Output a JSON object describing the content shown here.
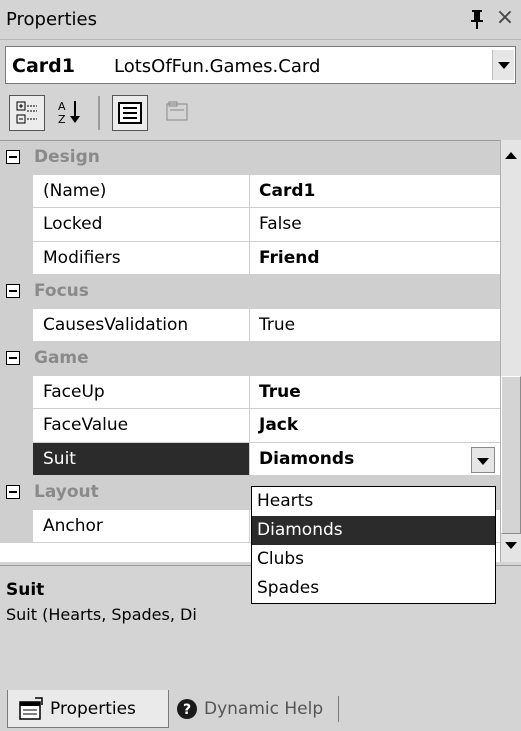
{
  "window": {
    "title": "Properties",
    "pin_glyph": "ᵖ",
    "close_glyph": "×"
  },
  "object_selector": {
    "name": "Card1",
    "type": "LotsOfFun.Games.Card"
  },
  "toolbar": {
    "buttons": [
      {
        "name": "categorized-icon",
        "pressed": true
      },
      {
        "name": "alphabetical-icon",
        "pressed": false
      },
      {
        "name": "properties-icon",
        "pressed": true
      },
      {
        "name": "property-pages-icon",
        "disabled": true
      }
    ]
  },
  "grid": {
    "rows": [
      {
        "kind": "category",
        "label": "Design"
      },
      {
        "kind": "property",
        "name": "(Name)",
        "value": "Card1",
        "bold": true
      },
      {
        "kind": "property",
        "name": "Locked",
        "value": "False",
        "bold": false
      },
      {
        "kind": "property",
        "name": "Modifiers",
        "value": "Friend",
        "bold": true
      },
      {
        "kind": "category",
        "label": "Focus"
      },
      {
        "kind": "property",
        "name": "CausesValidation",
        "value": "True",
        "bold": false
      },
      {
        "kind": "category",
        "label": "Game"
      },
      {
        "kind": "property",
        "name": "FaceUp",
        "value": "True",
        "bold": true
      },
      {
        "kind": "property",
        "name": "FaceValue",
        "value": "Jack",
        "bold": true
      },
      {
        "kind": "property",
        "name": "Suit",
        "value": "Diamonds",
        "bold": true,
        "selected": true
      },
      {
        "kind": "category",
        "label": "Layout"
      },
      {
        "kind": "property",
        "name": "Anchor",
        "value": "",
        "bold": false
      }
    ]
  },
  "suit_dropdown": {
    "options": [
      "Hearts",
      "Diamonds",
      "Clubs",
      "Spades"
    ],
    "highlighted": "Diamonds"
  },
  "description": {
    "title": "Suit",
    "text": "Suit (Hearts, Spades, Di"
  },
  "tabs": [
    {
      "label": "Properties",
      "active": true
    },
    {
      "label": "Dynamic Help",
      "active": false
    }
  ],
  "colors": {
    "selection": "#2b2b2b",
    "category_bg": "#cfcfcf",
    "category_text": "#8a8a8a"
  }
}
